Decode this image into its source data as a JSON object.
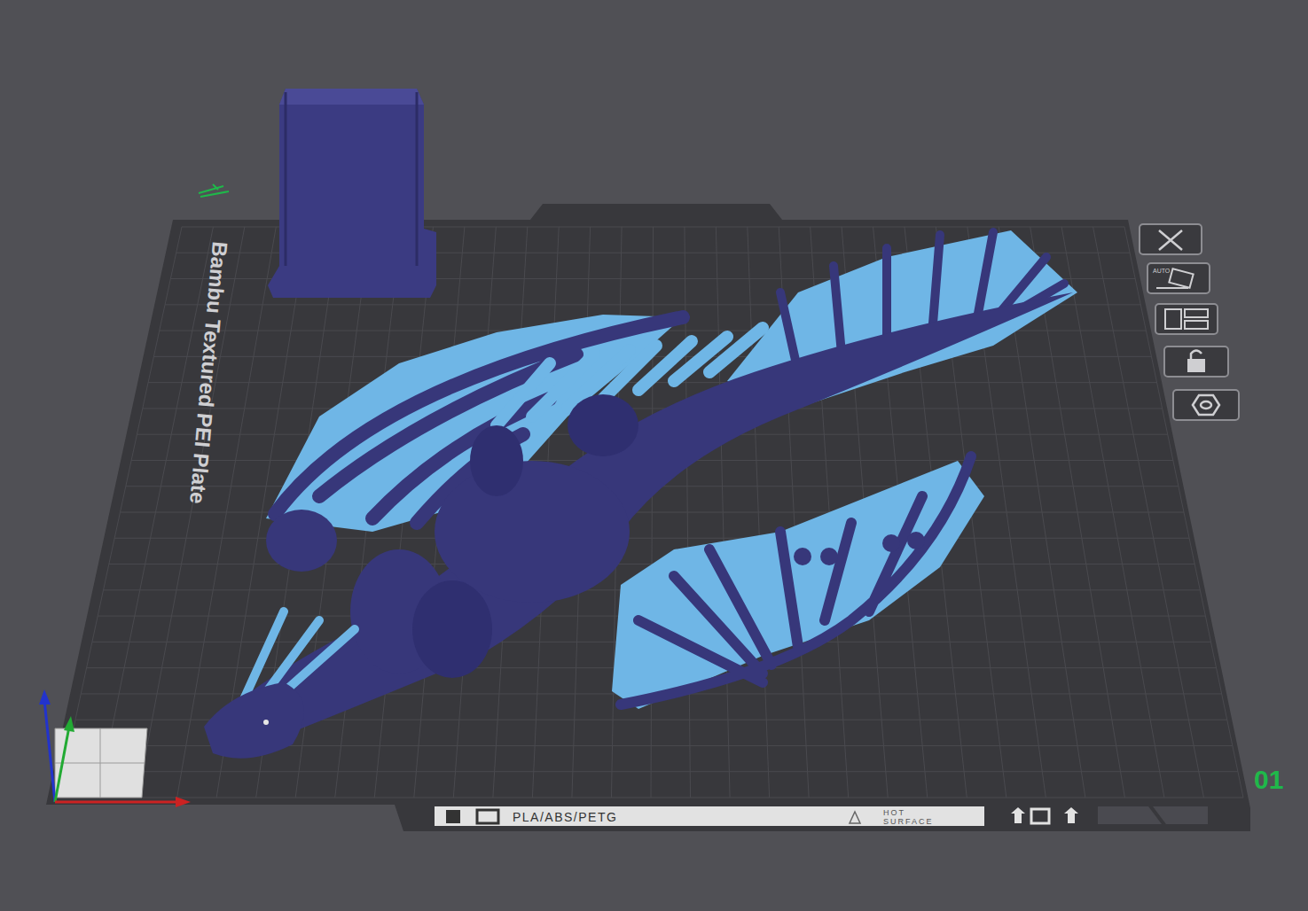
{
  "plate": {
    "name": "Bambu Textured PEI Plate",
    "filament_label": "PLA/ABS/PETG",
    "warning_lines": [
      "HOT",
      "SURFACE"
    ],
    "number": "01"
  },
  "toolbar": {
    "auto_label": "AUTO"
  }
}
